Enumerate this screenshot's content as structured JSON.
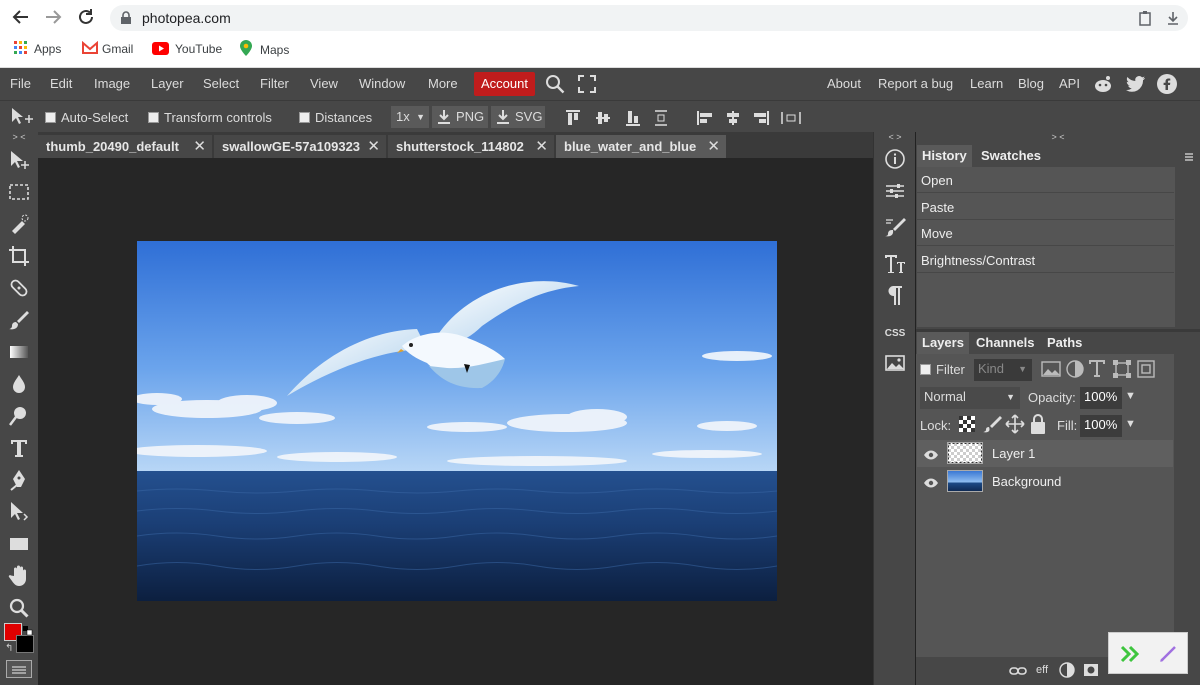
{
  "browser": {
    "url": "photopea.com",
    "bookmarks": [
      {
        "label": "Apps"
      },
      {
        "label": "Gmail"
      },
      {
        "label": "YouTube"
      },
      {
        "label": "Maps"
      }
    ]
  },
  "menu": {
    "items": [
      "File",
      "Edit",
      "Image",
      "Layer",
      "Select",
      "Filter",
      "View",
      "Window",
      "More"
    ],
    "account": "Account",
    "right_links": [
      "About",
      "Report a bug",
      "Learn",
      "Blog",
      "API"
    ]
  },
  "options": {
    "auto_select": "Auto-Select",
    "transform_controls": "Transform controls",
    "distances": "Distances",
    "zoom": "1x",
    "png": "PNG",
    "svg": "SVG"
  },
  "tabs": [
    {
      "name": "thumb_20490_default",
      "active": false
    },
    {
      "name": "swallowGE-57a109323",
      "active": false
    },
    {
      "name": "shutterstock_114802",
      "active": false
    },
    {
      "name": "blue_water_and_blue",
      "active": true
    }
  ],
  "history": {
    "tab_history": "History",
    "tab_swatches": "Swatches",
    "items": [
      "Open",
      "Paste",
      "Move",
      "Brightness/Contrast"
    ]
  },
  "layers_panel": {
    "tab_layers": "Layers",
    "tab_channels": "Channels",
    "tab_paths": "Paths",
    "filter_label": "Filter",
    "kind_label": "Kind",
    "blend_mode": "Normal",
    "opacity_label": "Opacity:",
    "opacity_value": "100%",
    "lock_label": "Lock:",
    "fill_label": "Fill:",
    "fill_value": "100%",
    "layers": [
      {
        "name": "Layer 1",
        "selected": true
      },
      {
        "name": "Background",
        "selected": false
      }
    ],
    "footer_eff": "eff"
  },
  "colors": {
    "foreground": "#e00000",
    "background": "#000000",
    "accent": "#c01c1c"
  }
}
